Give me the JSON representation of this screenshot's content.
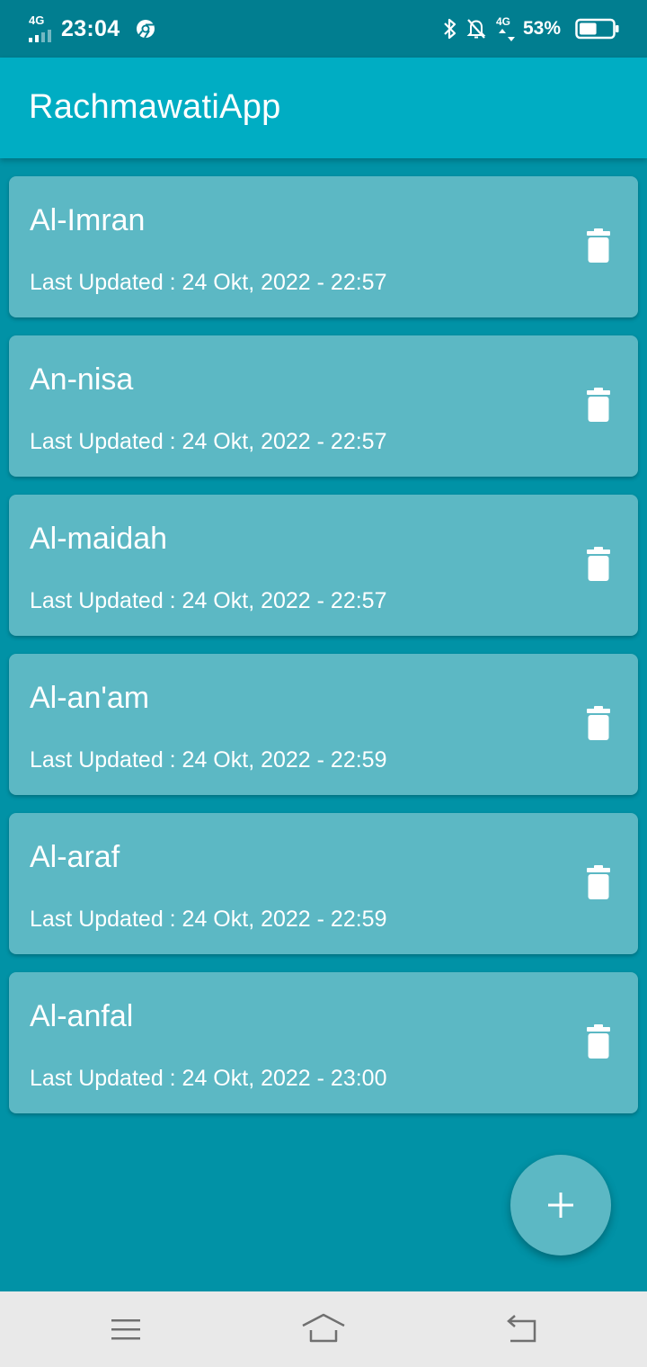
{
  "status_bar": {
    "network_label": "4G",
    "time": "23:04",
    "network_label_right": "4G",
    "battery_percent": "53%",
    "battery_level": 0.53
  },
  "app_bar": {
    "title": "RachmawatiApp"
  },
  "notes": [
    {
      "title": "Al-Imran",
      "updated": "Last Updated : 24 Okt, 2022 - 22:57"
    },
    {
      "title": "An-nisa",
      "updated": "Last Updated : 24 Okt, 2022 - 22:57"
    },
    {
      "title": "Al-maidah",
      "updated": "Last Updated : 24 Okt, 2022 - 22:57"
    },
    {
      "title": "Al-an'am",
      "updated": "Last Updated : 24 Okt, 2022 - 22:59"
    },
    {
      "title": "Al-araf",
      "updated": "Last Updated : 24 Okt, 2022 - 22:59"
    },
    {
      "title": "Al-anfal",
      "updated": "Last Updated : 24 Okt, 2022 - 23:00"
    }
  ],
  "icons": {
    "delete": "trash-icon",
    "fab": "plus-icon",
    "nav_menu": "menu-icon",
    "nav_home": "home-icon",
    "nav_back": "back-icon"
  },
  "colors": {
    "status_bar": "#017e90",
    "app_bar": "#00adc3",
    "background": "#0192a6",
    "card": "#5cb8c4",
    "nav_bar": "#e9e9e9"
  }
}
